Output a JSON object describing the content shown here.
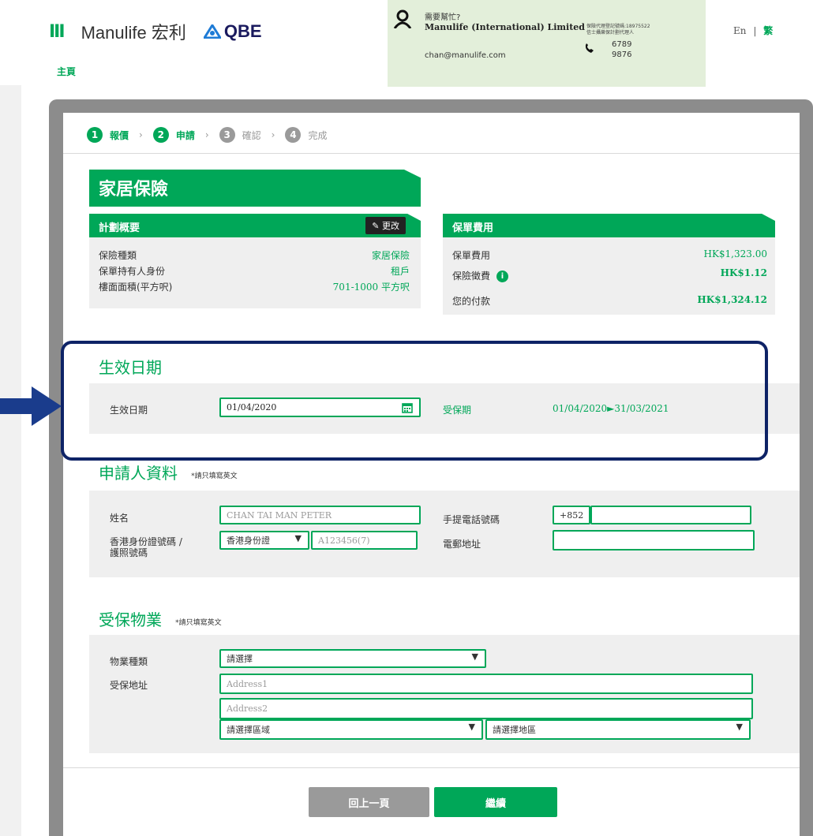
{
  "header": {
    "brand_bars": "III",
    "brand_text": "Manulife 宏利",
    "qbe_text": "QBE",
    "help": {
      "question": "需要幫忙?",
      "company": "Manulife (International) Limited",
      "reg_line1": "保險代理登記號碼:18975522",
      "reg_line2": "信士攝樂保計劃代理人",
      "email": "chan@manulife.com",
      "phone_line1": "6789",
      "phone_line2": "9876"
    },
    "lang_en": "En",
    "lang_sep": "|",
    "lang_tc": "繁"
  },
  "breadcrumb": {
    "home": "主頁"
  },
  "steps": [
    {
      "num": "1",
      "label": "報價",
      "state": "active"
    },
    {
      "num": "2",
      "label": "申請",
      "state": "active"
    },
    {
      "num": "3",
      "label": "確認",
      "state": "inactive"
    },
    {
      "num": "4",
      "label": "完成",
      "state": "inactive"
    }
  ],
  "product_title": "家居保險",
  "plan_summary": {
    "title": "計劃概要",
    "edit_label": "更改",
    "rows": [
      {
        "label": "保險種類",
        "value": "家居保險"
      },
      {
        "label": "保單持有人身份",
        "value": "租戶"
      },
      {
        "label": "樓面面積(平方呎)",
        "value": "701-1000 平方呎"
      }
    ]
  },
  "premium": {
    "title": "保單費用",
    "rows": [
      {
        "label": "保單費用",
        "value": "HK$1,323.00"
      },
      {
        "label": "保險徵費",
        "value": "HK$1.12",
        "info_icon": "i"
      },
      {
        "label": "您的付款",
        "value": "HK$1,324.12"
      }
    ]
  },
  "effective_date": {
    "section_title": "生效日期",
    "label": "生效日期",
    "value": "01/04/2020",
    "coverage_label": "受保期",
    "coverage_value": "01/04/2020►31/03/2021"
  },
  "applicant": {
    "section_title": "申請人資料",
    "note": "*請只填寫英文",
    "name_label": "姓名",
    "name_value": "CHAN TAI MAN PETER",
    "id_label_1": "香港身份證號碼 /",
    "id_label_2": "護照號碼",
    "id_type": "香港身份證",
    "id_placeholder": "A123456(7)",
    "mobile_label": "手提電話號碼",
    "country_code": "+852",
    "mobile_value": "",
    "email_label": "電郵地址",
    "email_value": ""
  },
  "property": {
    "section_title": "受保物業",
    "note": "*請只填寫英文",
    "type_label": "物業種類",
    "type_value": "請選擇",
    "address_label": "受保地址",
    "address1_placeholder": "Address1",
    "address2_placeholder": "Address2",
    "region_value": "請選擇區域",
    "district_value": "請選擇地區"
  },
  "buttons": {
    "back": "回上一頁",
    "next": "繼續"
  },
  "colors": {
    "brand_green": "#00a758",
    "highlight_navy": "#0e2366",
    "arrow_blue": "#1a3c8c"
  }
}
